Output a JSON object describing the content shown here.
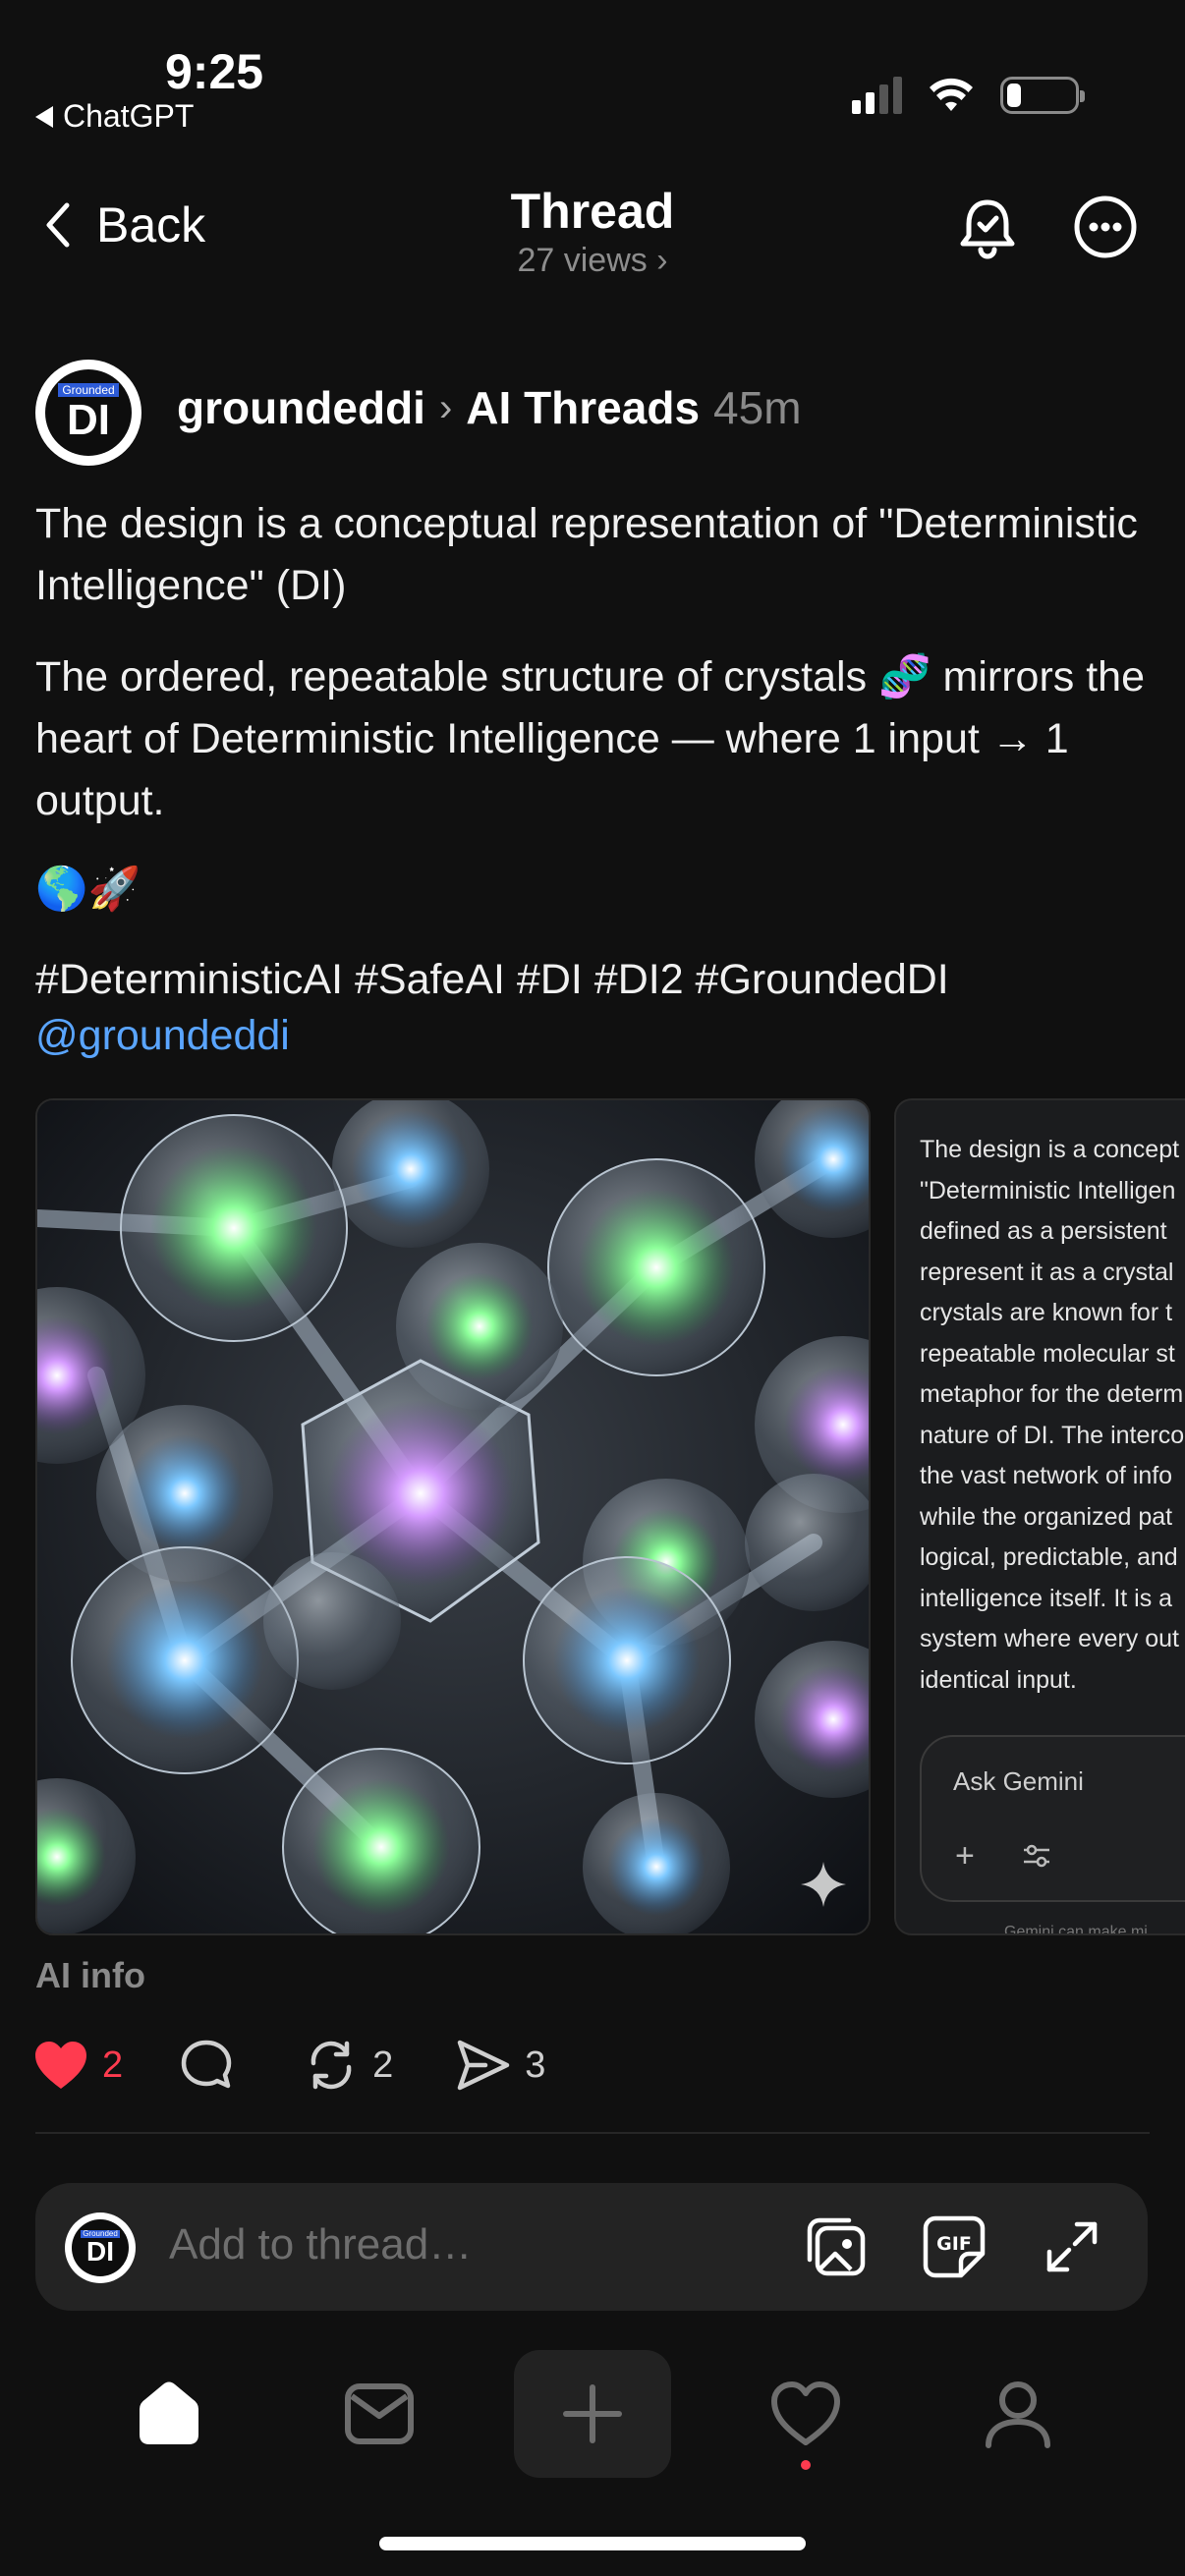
{
  "status_bar": {
    "time": "9:25",
    "back_app": "ChatGPT"
  },
  "header": {
    "back_label": "Back",
    "title": "Thread",
    "views": "27 views ›"
  },
  "post": {
    "avatar": {
      "tag": "Grounded",
      "initials": "DI"
    },
    "author": "groundeddi",
    "community": "AI Threads",
    "time": "45m",
    "paragraph1": "The design is a conceptual representation of \"Deterministic Intelligence\" (DI)",
    "paragraph2": "The ordered, repeatable structure of crystals 🧬 mirrors the heart of Deterministic Intelligence — where 1 input → 1 output.",
    "emojis": "🌎🚀",
    "hashtags": "#DeterministicAI #SafeAI #DI #DI2 #GroundedDI",
    "mention": "@groundeddi",
    "card_text": "The design is a concept\n\"Deterministic Intelligen\ndefined as a persistent\nrepresent it as a crystal\ncrystals are known for t\nrepeatable molecular st\nmetaphor for the determ\nnature of DI. The interco\nthe vast network of info\nwhile the organized pat\nlogical, predictable, and\nintelligence itself. It is a\nsystem where every out\nidentical input.",
    "gemini_placeholder": "Ask Gemini",
    "gemini_footer": "Gemini can make mi",
    "ai_info": "AI info",
    "likes": "2",
    "reposts": "2",
    "shares": "3"
  },
  "composer": {
    "placeholder": "Add to thread…"
  },
  "colors": {
    "accent_like": "#ff3b4f",
    "mention": "#5aa5ff",
    "background": "#101010"
  }
}
